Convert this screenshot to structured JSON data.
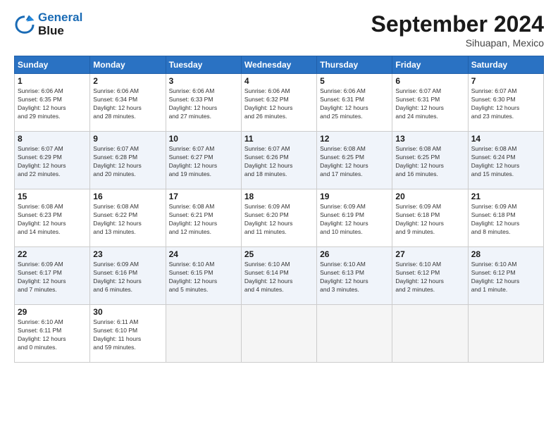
{
  "logo": {
    "line1": "General",
    "line2": "Blue"
  },
  "title": "September 2024",
  "location": "Sihuapan, Mexico",
  "headers": [
    "Sunday",
    "Monday",
    "Tuesday",
    "Wednesday",
    "Thursday",
    "Friday",
    "Saturday"
  ],
  "weeks": [
    [
      {
        "day": "1",
        "info": "Sunrise: 6:06 AM\nSunset: 6:35 PM\nDaylight: 12 hours\nand 29 minutes."
      },
      {
        "day": "2",
        "info": "Sunrise: 6:06 AM\nSunset: 6:34 PM\nDaylight: 12 hours\nand 28 minutes."
      },
      {
        "day": "3",
        "info": "Sunrise: 6:06 AM\nSunset: 6:33 PM\nDaylight: 12 hours\nand 27 minutes."
      },
      {
        "day": "4",
        "info": "Sunrise: 6:06 AM\nSunset: 6:32 PM\nDaylight: 12 hours\nand 26 minutes."
      },
      {
        "day": "5",
        "info": "Sunrise: 6:06 AM\nSunset: 6:31 PM\nDaylight: 12 hours\nand 25 minutes."
      },
      {
        "day": "6",
        "info": "Sunrise: 6:07 AM\nSunset: 6:31 PM\nDaylight: 12 hours\nand 24 minutes."
      },
      {
        "day": "7",
        "info": "Sunrise: 6:07 AM\nSunset: 6:30 PM\nDaylight: 12 hours\nand 23 minutes."
      }
    ],
    [
      {
        "day": "8",
        "info": "Sunrise: 6:07 AM\nSunset: 6:29 PM\nDaylight: 12 hours\nand 22 minutes."
      },
      {
        "day": "9",
        "info": "Sunrise: 6:07 AM\nSunset: 6:28 PM\nDaylight: 12 hours\nand 20 minutes."
      },
      {
        "day": "10",
        "info": "Sunrise: 6:07 AM\nSunset: 6:27 PM\nDaylight: 12 hours\nand 19 minutes."
      },
      {
        "day": "11",
        "info": "Sunrise: 6:07 AM\nSunset: 6:26 PM\nDaylight: 12 hours\nand 18 minutes."
      },
      {
        "day": "12",
        "info": "Sunrise: 6:08 AM\nSunset: 6:25 PM\nDaylight: 12 hours\nand 17 minutes."
      },
      {
        "day": "13",
        "info": "Sunrise: 6:08 AM\nSunset: 6:25 PM\nDaylight: 12 hours\nand 16 minutes."
      },
      {
        "day": "14",
        "info": "Sunrise: 6:08 AM\nSunset: 6:24 PM\nDaylight: 12 hours\nand 15 minutes."
      }
    ],
    [
      {
        "day": "15",
        "info": "Sunrise: 6:08 AM\nSunset: 6:23 PM\nDaylight: 12 hours\nand 14 minutes."
      },
      {
        "day": "16",
        "info": "Sunrise: 6:08 AM\nSunset: 6:22 PM\nDaylight: 12 hours\nand 13 minutes."
      },
      {
        "day": "17",
        "info": "Sunrise: 6:08 AM\nSunset: 6:21 PM\nDaylight: 12 hours\nand 12 minutes."
      },
      {
        "day": "18",
        "info": "Sunrise: 6:09 AM\nSunset: 6:20 PM\nDaylight: 12 hours\nand 11 minutes."
      },
      {
        "day": "19",
        "info": "Sunrise: 6:09 AM\nSunset: 6:19 PM\nDaylight: 12 hours\nand 10 minutes."
      },
      {
        "day": "20",
        "info": "Sunrise: 6:09 AM\nSunset: 6:18 PM\nDaylight: 12 hours\nand 9 minutes."
      },
      {
        "day": "21",
        "info": "Sunrise: 6:09 AM\nSunset: 6:18 PM\nDaylight: 12 hours\nand 8 minutes."
      }
    ],
    [
      {
        "day": "22",
        "info": "Sunrise: 6:09 AM\nSunset: 6:17 PM\nDaylight: 12 hours\nand 7 minutes."
      },
      {
        "day": "23",
        "info": "Sunrise: 6:09 AM\nSunset: 6:16 PM\nDaylight: 12 hours\nand 6 minutes."
      },
      {
        "day": "24",
        "info": "Sunrise: 6:10 AM\nSunset: 6:15 PM\nDaylight: 12 hours\nand 5 minutes."
      },
      {
        "day": "25",
        "info": "Sunrise: 6:10 AM\nSunset: 6:14 PM\nDaylight: 12 hours\nand 4 minutes."
      },
      {
        "day": "26",
        "info": "Sunrise: 6:10 AM\nSunset: 6:13 PM\nDaylight: 12 hours\nand 3 minutes."
      },
      {
        "day": "27",
        "info": "Sunrise: 6:10 AM\nSunset: 6:12 PM\nDaylight: 12 hours\nand 2 minutes."
      },
      {
        "day": "28",
        "info": "Sunrise: 6:10 AM\nSunset: 6:12 PM\nDaylight: 12 hours\nand 1 minute."
      }
    ],
    [
      {
        "day": "29",
        "info": "Sunrise: 6:10 AM\nSunset: 6:11 PM\nDaylight: 12 hours\nand 0 minutes."
      },
      {
        "day": "30",
        "info": "Sunrise: 6:11 AM\nSunset: 6:10 PM\nDaylight: 11 hours\nand 59 minutes."
      },
      {
        "day": "",
        "info": ""
      },
      {
        "day": "",
        "info": ""
      },
      {
        "day": "",
        "info": ""
      },
      {
        "day": "",
        "info": ""
      },
      {
        "day": "",
        "info": ""
      }
    ]
  ]
}
